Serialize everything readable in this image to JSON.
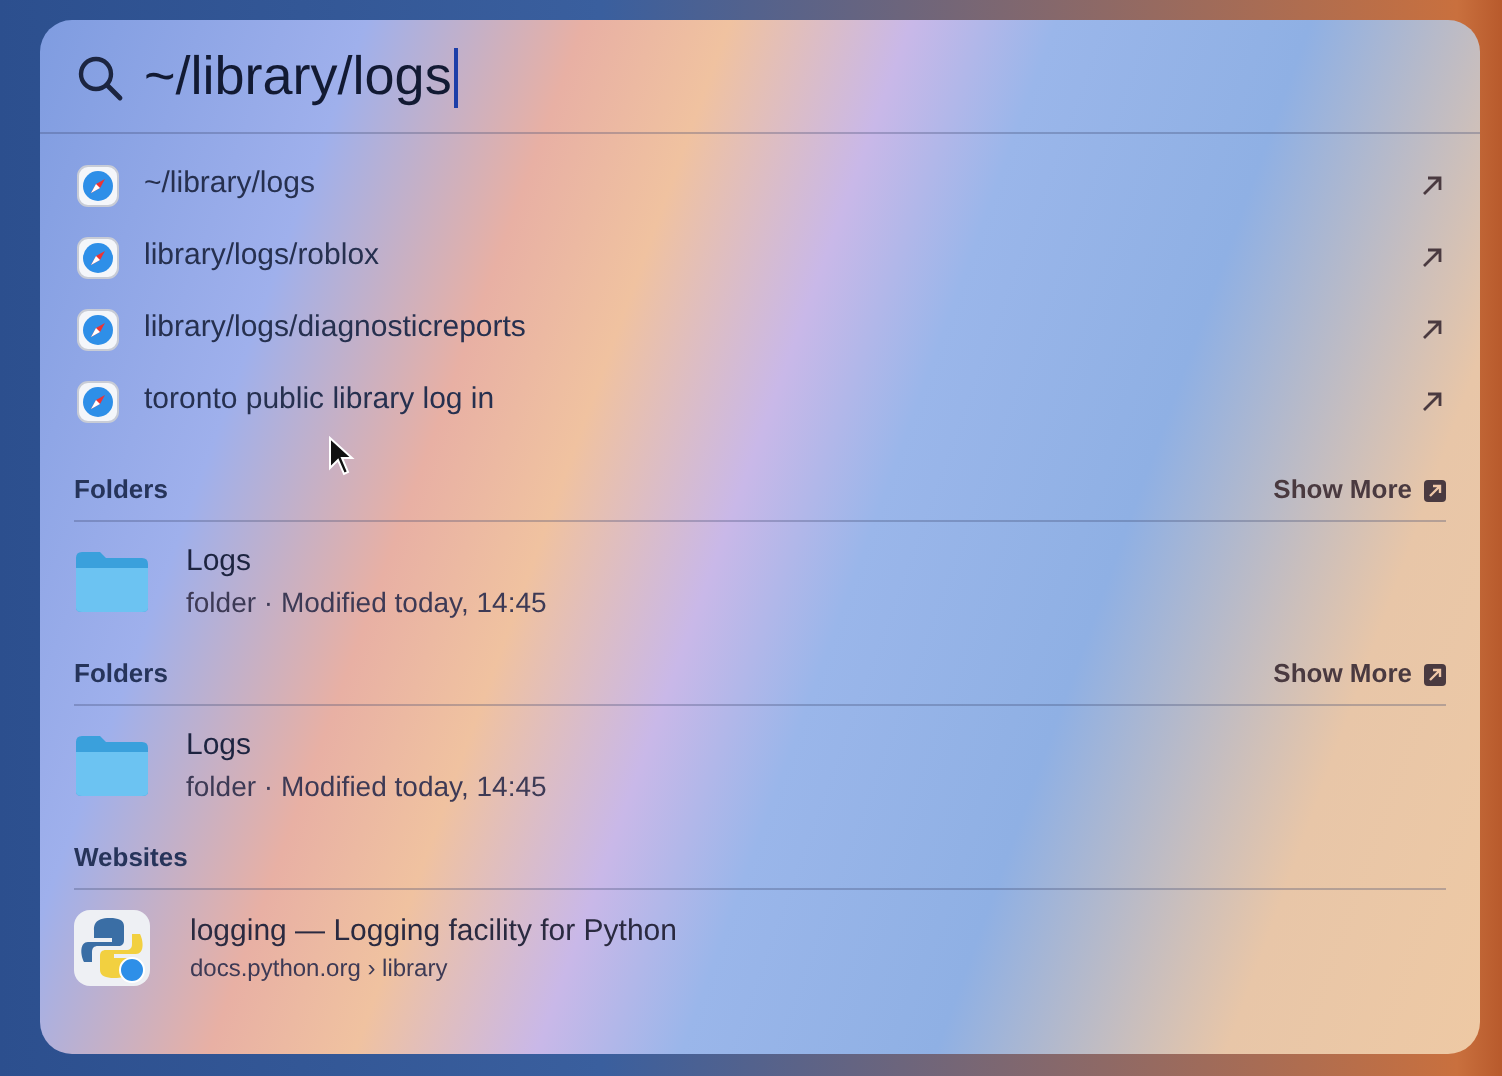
{
  "search": {
    "value": "~/library/logs"
  },
  "suggestions": [
    {
      "text": "~/library/logs"
    },
    {
      "text": "library/logs/roblox"
    },
    {
      "text": "library/logs/diagnosticreports"
    },
    {
      "text": "toronto public library log in"
    }
  ],
  "sections": [
    {
      "title": "Folders",
      "show_more": "Show More",
      "items": [
        {
          "kind": "folder",
          "title": "Logs",
          "subtitle": "folder · Modified today, 14:45"
        }
      ]
    },
    {
      "title": "Folders",
      "show_more": "Show More",
      "items": [
        {
          "kind": "folder",
          "title": "Logs",
          "subtitle": "folder · Modified today, 14:45"
        }
      ]
    },
    {
      "title": "Websites",
      "items": [
        {
          "kind": "website",
          "title": "logging — Logging facility for Python",
          "subtitle": "docs.python.org › library"
        }
      ]
    }
  ]
}
